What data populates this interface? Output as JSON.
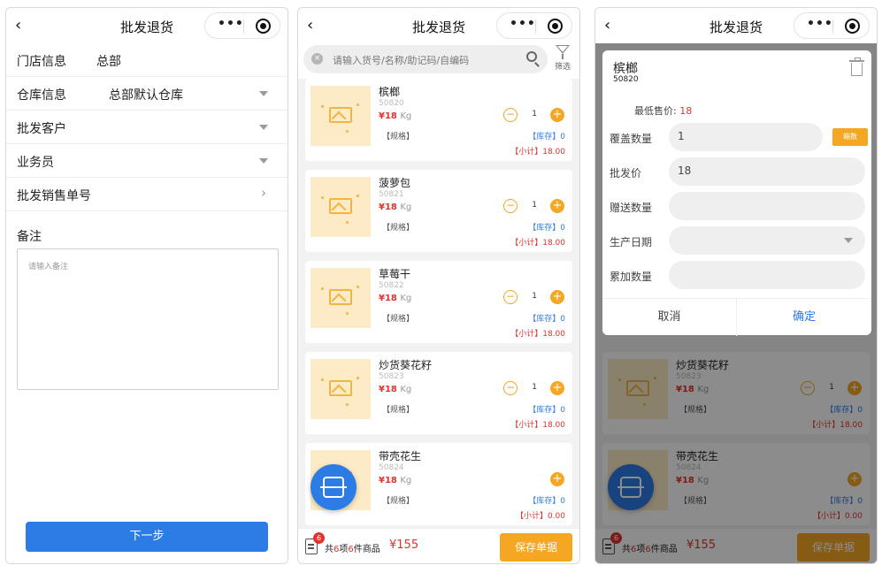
{
  "colors": {
    "primary": "#2d7be5",
    "accent": "#f5a623",
    "price": "#e0342d"
  },
  "nav": {
    "title": "批发退货",
    "back_icon": "‹",
    "more_icon": "•••"
  },
  "form": {
    "store_label": "门店信息",
    "store_value": "总部",
    "warehouse_label": "仓库信息",
    "warehouse_value": "总部默认仓库",
    "customer_label": "批发客户",
    "salesman_label": "业务员",
    "order_label": "批发销售单号",
    "remark_label": "备注",
    "remark_placeholder": "请输入备注",
    "next_button": "下一步"
  },
  "search": {
    "placeholder": "请输入货号/名称/助记码/自编码",
    "filter_label": "筛选"
  },
  "product_common": {
    "spec": "【规格】",
    "stock_label": "【库存】",
    "subtotal_label": "【小计】",
    "price_unit": "Kg"
  },
  "products": [
    {
      "name": "槟榔",
      "code": "50820",
      "price": "¥18",
      "qty": "1",
      "stock": "0",
      "subtotal": "18.00"
    },
    {
      "name": "菠萝包",
      "code": "50821",
      "price": "¥18",
      "qty": "1",
      "stock": "0",
      "subtotal": "18.00"
    },
    {
      "name": "草莓干",
      "code": "50822",
      "price": "¥18",
      "qty": "1",
      "stock": "0",
      "subtotal": "18.00"
    },
    {
      "name": "炒货葵花籽",
      "code": "50823",
      "price": "¥18",
      "qty": "1",
      "stock": "0",
      "subtotal": "18.00"
    },
    {
      "name": "带壳花生",
      "code": "50824",
      "price": "¥18",
      "qty": "",
      "stock": "0",
      "subtotal": "0.00"
    }
  ],
  "bottom": {
    "badge": "6",
    "summary_prefix": "共",
    "items": "6",
    "summary_mid": "项",
    "pieces": "6",
    "summary_suffix": "件商品",
    "total": "¥155",
    "save_button": "保存单据"
  },
  "modal": {
    "name": "槟榔",
    "code": "50820",
    "min_price_label": "最低售价:",
    "min_price": "18",
    "cover_qty_label": "覆盖数量",
    "cover_qty": "1",
    "box_button": "箱数",
    "wholesale_price_label": "批发价",
    "wholesale_price": "18",
    "gift_qty_label": "赠送数量",
    "prod_date_label": "生产日期",
    "accum_qty_label": "累加数量",
    "cancel": "取消",
    "confirm": "确定"
  }
}
